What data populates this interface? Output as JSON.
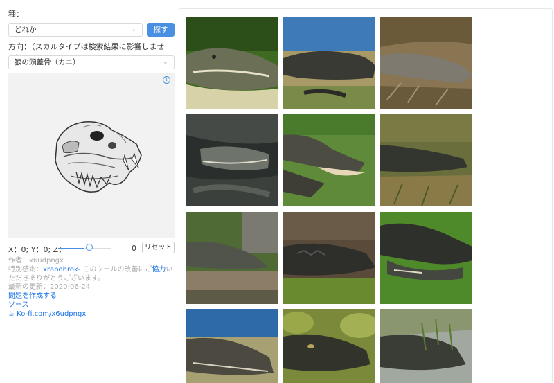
{
  "sidebar": {
    "species_label": "種：",
    "species_value": "どれか",
    "search_label": "探す",
    "direction_label": "方向：（スカルタイプは検索結果に影響しません）",
    "direction_value": "狼の頭蓋骨（カニ）",
    "info_glyph": "i",
    "xyz_label": "X：0; Y：0; Z：",
    "slider_value": "0",
    "slider_level": 0.5,
    "reset_label": "リセット",
    "author_prefix": "作者：",
    "author_name": "x6udpngx",
    "thanks_prefix": "特別感謝：",
    "thanks_name": "xrabohrok-",
    "thanks_text_a": " このツールの改善にご",
    "thanks_highlight": "協力",
    "thanks_text_b": "いただきありがとうございます。",
    "updated_prefix": "最新の更新：",
    "updated_date": "2020-06-24",
    "issue_link": "問題を作成する",
    "source_link": "ソース",
    "kofi_link": "Ko-fi.com/x6udpngx"
  },
  "colors": {
    "accent": "#4a90e2",
    "link": "#1a73e8",
    "viewer_bg": "#f2f2f2"
  },
  "results": {
    "images": [
      {
        "subject": "alligator-head-closeup",
        "bg": "#3f6a22"
      },
      {
        "subject": "alligator-by-water",
        "bg": "#3f7ab8"
      },
      {
        "subject": "alligator-in-dry-grass",
        "bg": "#8a7552"
      },
      {
        "subject": "alligators-group",
        "bg": "#2a2e2c"
      },
      {
        "subject": "alligator-open-mouth-on-grass",
        "bg": "#5e8a3a"
      },
      {
        "subject": "alligator-in-grass",
        "bg": "#6a6e3c"
      },
      {
        "subject": "alligator-on-log",
        "bg": "#4f6a34"
      },
      {
        "subject": "alligator-dark-closeup",
        "bg": "#5a4a3a"
      },
      {
        "subject": "alligator-green-grass",
        "bg": "#4f8a2a"
      },
      {
        "subject": "alligator-near-lake",
        "bg": "#2f6aa8"
      },
      {
        "subject": "alligator-among-lily-pads",
        "bg": "#7a8a3a"
      },
      {
        "subject": "alligator-in-reeds",
        "bg": "#a0a8a0"
      }
    ]
  }
}
